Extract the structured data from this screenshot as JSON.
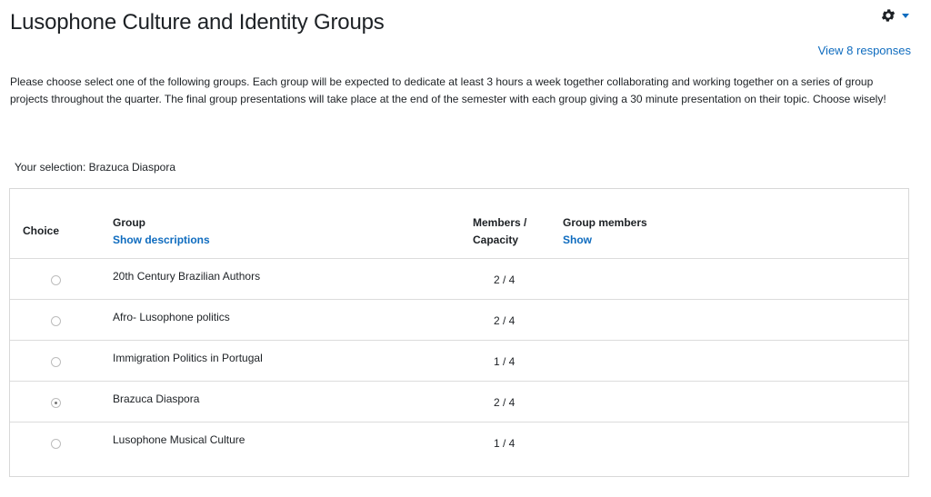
{
  "page": {
    "title": "Lusophone Culture and Identity Groups",
    "view_responses": "View 8 responses",
    "intro": "Please choose select one of the following groups. Each group will be expected to dedicate  at least 3 hours a week together collaborating and working together on a series of group projects throughout the quarter. The final group presentations will take place at the end of the semester with each group giving a 30 minute presentation on their topic. Choose wisely!",
    "selection": "Your selection: Brazuca Diaspora"
  },
  "header_icons": {
    "settings": "gear-icon",
    "menu": "caret-down-icon"
  },
  "colors": {
    "link": "#0f6cbf",
    "text": "#1d2125",
    "border": "#d8d8d8"
  },
  "table": {
    "headers": {
      "choice": "Choice",
      "group": "Group",
      "show_descriptions": "Show descriptions",
      "members_line1": "Members /",
      "members_line2": "Capacity",
      "group_members": "Group members",
      "show": "Show"
    },
    "rows": [
      {
        "name": "20th Century Brazilian Authors",
        "count": "2 / 4",
        "selected": false
      },
      {
        "name": "Afro- Lusophone politics",
        "count": "2 / 4",
        "selected": false
      },
      {
        "name": "Immigration Politics in Portugal",
        "count": "1 / 4",
        "selected": false
      },
      {
        "name": "Brazuca Diaspora",
        "count": "2 / 4",
        "selected": true
      },
      {
        "name": "Lusophone Musical Culture",
        "count": "1 / 4",
        "selected": false
      }
    ]
  }
}
